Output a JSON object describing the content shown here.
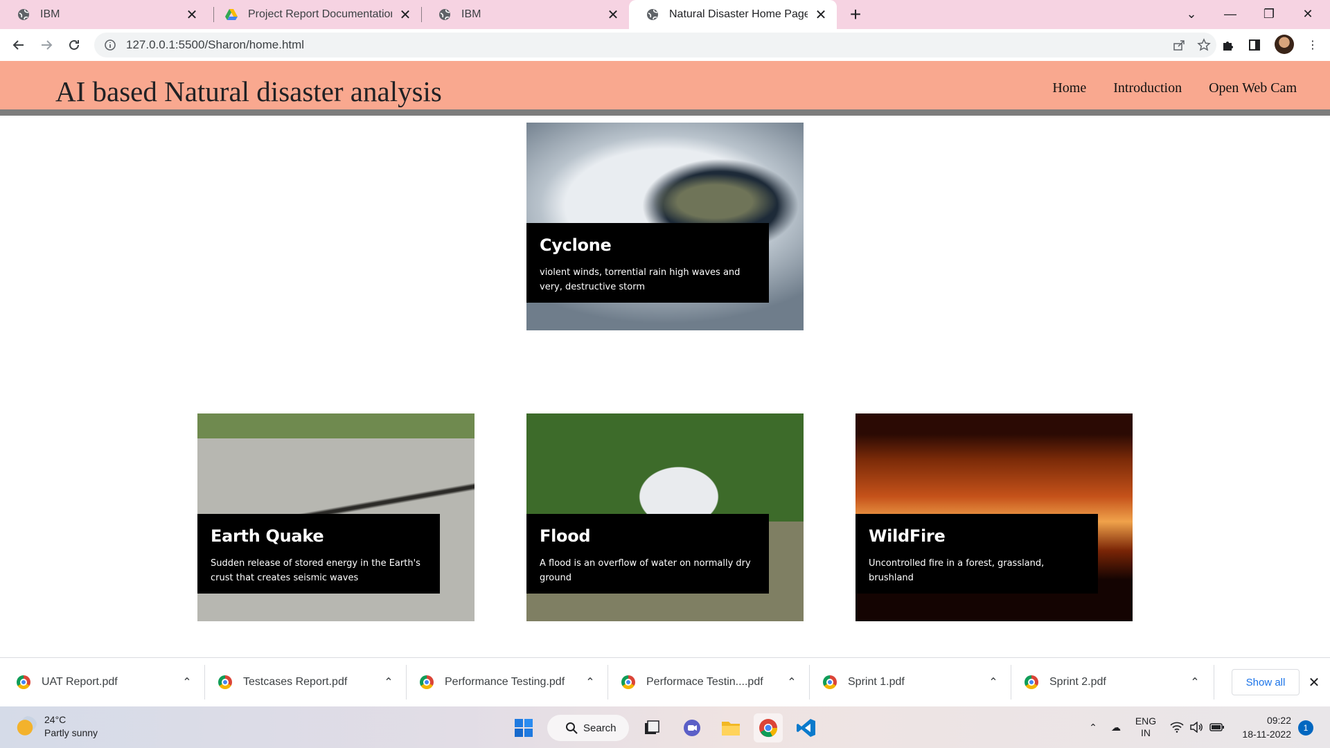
{
  "browser": {
    "tabs": [
      {
        "title": "IBM",
        "icon": "globe-icon",
        "active": false
      },
      {
        "title": "Project Report Documentation Fo",
        "icon": "google-drive-icon",
        "active": false
      },
      {
        "title": "IBM",
        "icon": "globe-icon",
        "active": false
      },
      {
        "title": "Natural Disaster Home Page",
        "icon": "globe-icon",
        "active": true
      }
    ],
    "url": "127.0.0.1:5500/Sharon/home.html"
  },
  "page": {
    "title": "AI based Natural disaster analysis",
    "nav": [
      "Home",
      "Introduction",
      "Open Web Cam"
    ],
    "header_color": "#f9a88f",
    "cards": [
      {
        "title": "Cyclone",
        "description": "violent winds, torrential rain high waves and very, destructive storm"
      },
      {
        "title": "Earth Quake",
        "description": "Sudden release of stored energy in the Earth's crust that creates seismic waves"
      },
      {
        "title": "Flood",
        "description": "A flood is an overflow of water on normally dry ground"
      },
      {
        "title": "WildFire",
        "description": "Uncontrolled fire in a forest, grassland, brushland"
      }
    ]
  },
  "downloads": {
    "items": [
      "UAT Report.pdf",
      "Testcases Report.pdf",
      "Performance Testing.pdf",
      "Performace Testin....pdf",
      "Sprint 1.pdf",
      "Sprint 2.pdf"
    ],
    "show_all": "Show all"
  },
  "taskbar": {
    "weather_temp": "24°C",
    "weather_desc": "Partly sunny",
    "search_label": "Search",
    "lang_top": "ENG",
    "lang_bottom": "IN",
    "time": "09:22",
    "date": "18-11-2022",
    "notification_count": "1"
  }
}
